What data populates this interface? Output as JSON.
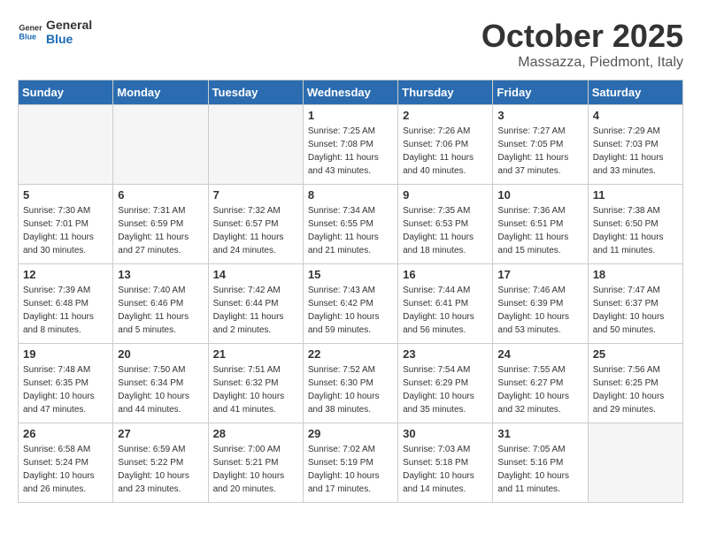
{
  "header": {
    "logo_general": "General",
    "logo_blue": "Blue",
    "month_title": "October 2025",
    "location": "Massazza, Piedmont, Italy"
  },
  "days_of_week": [
    "Sunday",
    "Monday",
    "Tuesday",
    "Wednesday",
    "Thursday",
    "Friday",
    "Saturday"
  ],
  "weeks": [
    [
      {
        "day": "",
        "empty": true
      },
      {
        "day": "",
        "empty": true
      },
      {
        "day": "",
        "empty": true
      },
      {
        "day": "1",
        "sunrise": "7:25 AM",
        "sunset": "7:08 PM",
        "daylight": "11 hours and 43 minutes."
      },
      {
        "day": "2",
        "sunrise": "7:26 AM",
        "sunset": "7:06 PM",
        "daylight": "11 hours and 40 minutes."
      },
      {
        "day": "3",
        "sunrise": "7:27 AM",
        "sunset": "7:05 PM",
        "daylight": "11 hours and 37 minutes."
      },
      {
        "day": "4",
        "sunrise": "7:29 AM",
        "sunset": "7:03 PM",
        "daylight": "11 hours and 33 minutes."
      }
    ],
    [
      {
        "day": "5",
        "sunrise": "7:30 AM",
        "sunset": "7:01 PM",
        "daylight": "11 hours and 30 minutes."
      },
      {
        "day": "6",
        "sunrise": "7:31 AM",
        "sunset": "6:59 PM",
        "daylight": "11 hours and 27 minutes."
      },
      {
        "day": "7",
        "sunrise": "7:32 AM",
        "sunset": "6:57 PM",
        "daylight": "11 hours and 24 minutes."
      },
      {
        "day": "8",
        "sunrise": "7:34 AM",
        "sunset": "6:55 PM",
        "daylight": "11 hours and 21 minutes."
      },
      {
        "day": "9",
        "sunrise": "7:35 AM",
        "sunset": "6:53 PM",
        "daylight": "11 hours and 18 minutes."
      },
      {
        "day": "10",
        "sunrise": "7:36 AM",
        "sunset": "6:51 PM",
        "daylight": "11 hours and 15 minutes."
      },
      {
        "day": "11",
        "sunrise": "7:38 AM",
        "sunset": "6:50 PM",
        "daylight": "11 hours and 11 minutes."
      }
    ],
    [
      {
        "day": "12",
        "sunrise": "7:39 AM",
        "sunset": "6:48 PM",
        "daylight": "11 hours and 8 minutes."
      },
      {
        "day": "13",
        "sunrise": "7:40 AM",
        "sunset": "6:46 PM",
        "daylight": "11 hours and 5 minutes."
      },
      {
        "day": "14",
        "sunrise": "7:42 AM",
        "sunset": "6:44 PM",
        "daylight": "11 hours and 2 minutes."
      },
      {
        "day": "15",
        "sunrise": "7:43 AM",
        "sunset": "6:42 PM",
        "daylight": "10 hours and 59 minutes."
      },
      {
        "day": "16",
        "sunrise": "7:44 AM",
        "sunset": "6:41 PM",
        "daylight": "10 hours and 56 minutes."
      },
      {
        "day": "17",
        "sunrise": "7:46 AM",
        "sunset": "6:39 PM",
        "daylight": "10 hours and 53 minutes."
      },
      {
        "day": "18",
        "sunrise": "7:47 AM",
        "sunset": "6:37 PM",
        "daylight": "10 hours and 50 minutes."
      }
    ],
    [
      {
        "day": "19",
        "sunrise": "7:48 AM",
        "sunset": "6:35 PM",
        "daylight": "10 hours and 47 minutes."
      },
      {
        "day": "20",
        "sunrise": "7:50 AM",
        "sunset": "6:34 PM",
        "daylight": "10 hours and 44 minutes."
      },
      {
        "day": "21",
        "sunrise": "7:51 AM",
        "sunset": "6:32 PM",
        "daylight": "10 hours and 41 minutes."
      },
      {
        "day": "22",
        "sunrise": "7:52 AM",
        "sunset": "6:30 PM",
        "daylight": "10 hours and 38 minutes."
      },
      {
        "day": "23",
        "sunrise": "7:54 AM",
        "sunset": "6:29 PM",
        "daylight": "10 hours and 35 minutes."
      },
      {
        "day": "24",
        "sunrise": "7:55 AM",
        "sunset": "6:27 PM",
        "daylight": "10 hours and 32 minutes."
      },
      {
        "day": "25",
        "sunrise": "7:56 AM",
        "sunset": "6:25 PM",
        "daylight": "10 hours and 29 minutes."
      }
    ],
    [
      {
        "day": "26",
        "sunrise": "6:58 AM",
        "sunset": "5:24 PM",
        "daylight": "10 hours and 26 minutes."
      },
      {
        "day": "27",
        "sunrise": "6:59 AM",
        "sunset": "5:22 PM",
        "daylight": "10 hours and 23 minutes."
      },
      {
        "day": "28",
        "sunrise": "7:00 AM",
        "sunset": "5:21 PM",
        "daylight": "10 hours and 20 minutes."
      },
      {
        "day": "29",
        "sunrise": "7:02 AM",
        "sunset": "5:19 PM",
        "daylight": "10 hours and 17 minutes."
      },
      {
        "day": "30",
        "sunrise": "7:03 AM",
        "sunset": "5:18 PM",
        "daylight": "10 hours and 14 minutes."
      },
      {
        "day": "31",
        "sunrise": "7:05 AM",
        "sunset": "5:16 PM",
        "daylight": "10 hours and 11 minutes."
      },
      {
        "day": "",
        "empty": true
      }
    ]
  ]
}
